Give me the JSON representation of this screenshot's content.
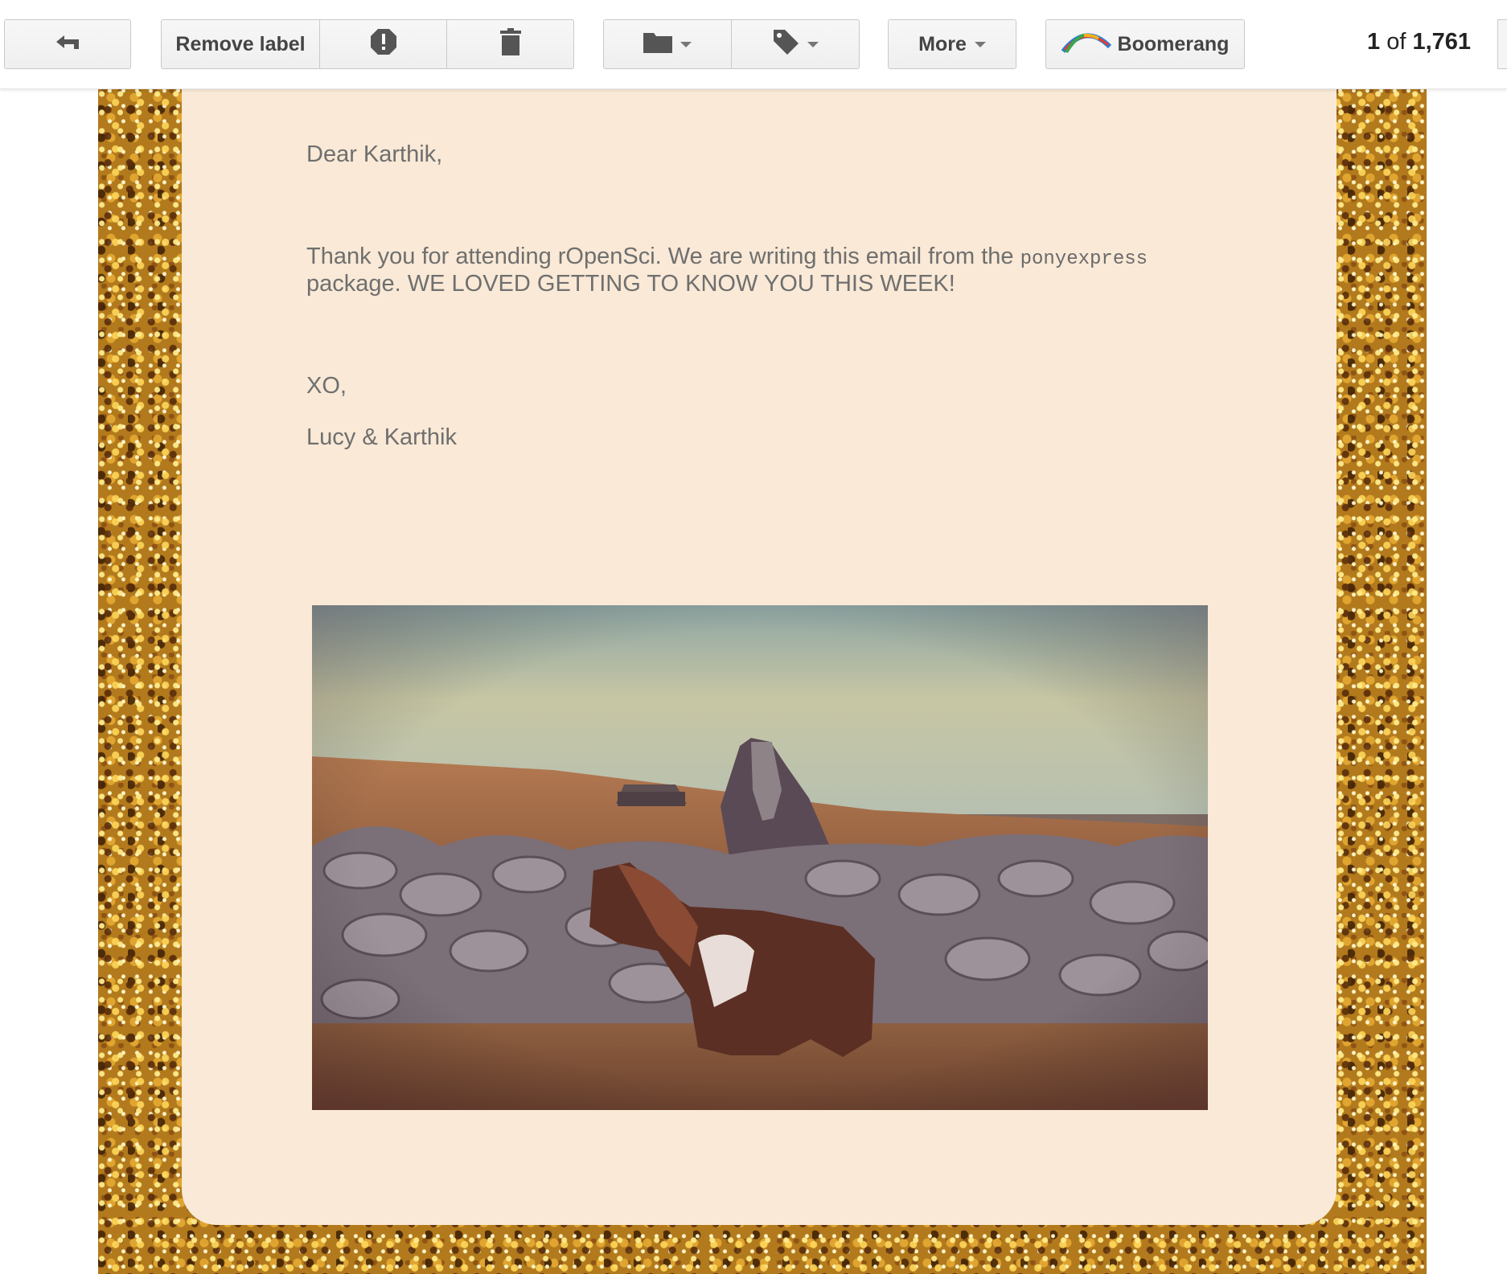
{
  "toolbar": {
    "remove_label": "Remove label",
    "more_label": "More",
    "boomerang_label": "Boomerang",
    "counter": {
      "current": "1",
      "of": "of",
      "total": "1,761"
    }
  },
  "icons": {
    "back": "back-arrow-icon",
    "spam": "report-spam-icon",
    "delete": "trash-icon",
    "move": "folder-icon",
    "labels": "tag-icon",
    "boomerang": "boomerang-icon"
  },
  "email": {
    "greeting": "Dear Karthik,",
    "body_part1": "Thank you for attending rOpenSci. We are writing this email from the ",
    "body_code": "ponyexpress",
    "body_part2": "package. WE LOVED GETTING TO KNOW YOU THIS WEEK!",
    "signoff": "XO,",
    "signature": "Lucy & Karthik"
  },
  "colors": {
    "card_background": "#f9e9d6",
    "glitter_gold": "#b27a1c",
    "text_gray": "#6f6f6f"
  }
}
